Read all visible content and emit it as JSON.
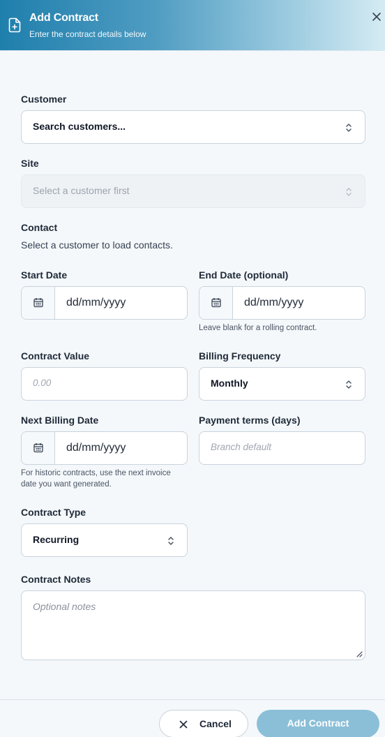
{
  "header": {
    "title": "Add Contract",
    "subtitle": "Enter the contract details below",
    "icon": "file-plus-icon",
    "close_icon": "close-icon"
  },
  "form": {
    "customer": {
      "label": "Customer",
      "value": "Search customers..."
    },
    "site": {
      "label": "Site",
      "value": "Select a customer first",
      "disabled": true
    },
    "contact": {
      "label": "Contact",
      "help": "Select a customer to load contacts."
    },
    "start_date": {
      "label": "Start Date",
      "value": "dd/mm/yyyy"
    },
    "end_date": {
      "label": "End Date (optional)",
      "value": "dd/mm/yyyy",
      "help": "Leave blank for a rolling contract."
    },
    "contract_value": {
      "label": "Contract Value",
      "placeholder": "0.00"
    },
    "billing_frequency": {
      "label": "Billing Frequency",
      "value": "Monthly"
    },
    "next_billing_date": {
      "label": "Next Billing Date",
      "value": "dd/mm/yyyy",
      "help_line1": "For historic contracts, use the next invoice",
      "help_line2": "date you want generated."
    },
    "payment_terms": {
      "label": "Payment terms (days)",
      "placeholder": "Branch default"
    },
    "contract_type": {
      "label": "Contract Type",
      "value": "Recurring"
    },
    "notes": {
      "label": "Contract Notes",
      "placeholder": "Optional notes"
    }
  },
  "footer": {
    "cancel_label": "Cancel",
    "submit_label": "Add Contract"
  },
  "colors": {
    "header_start": "#1f7fac",
    "header_end": "#d5ebf3",
    "submit_button": "#8bbfd8",
    "background": "#f4f8fb"
  }
}
